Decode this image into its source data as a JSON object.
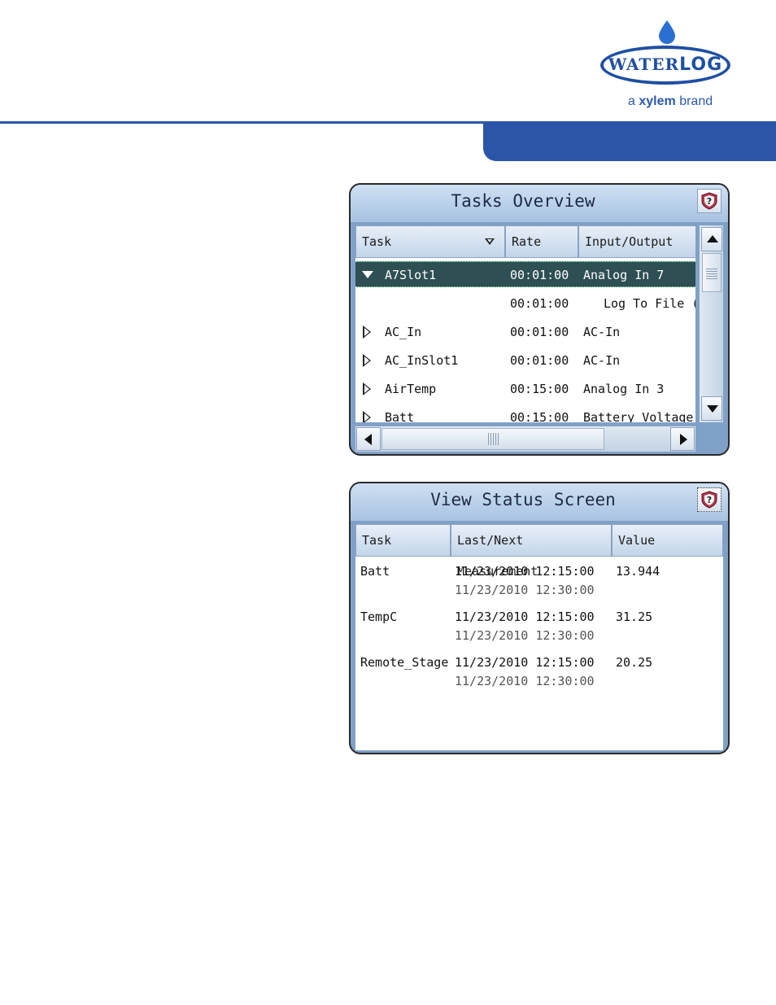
{
  "header": {
    "logo_left": "WATER",
    "logo_right": "LOG",
    "tagline_prefix": "a",
    "tagline_brand": "xylem",
    "tagline_suffix": "brand",
    "colors": {
      "brand_blue": "#2b56a8"
    }
  },
  "tasks_overview": {
    "title": "Tasks Overview",
    "help_icon": "help-shield-icon",
    "columns": [
      "Task",
      "Rate",
      "Input/Output"
    ],
    "rows": [
      {
        "task": "A7Slot1",
        "rate": "00:01:00",
        "io": "Analog In 7",
        "expanded": true,
        "selected": true
      },
      {
        "task": "",
        "rate": "00:01:00",
        "io": "Log To File (",
        "child": true
      },
      {
        "task": "AC_In",
        "rate": "00:01:00",
        "io": "AC-In"
      },
      {
        "task": "AC_InSlot1",
        "rate": "00:01:00",
        "io": "AC-In"
      },
      {
        "task": "AirTemp",
        "rate": "00:15:00",
        "io": "Analog In 3"
      },
      {
        "task": "Batt",
        "rate": "00:15:00",
        "io": "Battery Voltage"
      }
    ]
  },
  "view_status": {
    "title": "View Status Screen",
    "help_icon": "help-shield-icon",
    "columns": [
      "Task",
      "Last/Next Measurement",
      "Value"
    ],
    "rows": [
      {
        "task": "Batt",
        "last": "11/23/2010 12:15:00",
        "next": "11/23/2010 12:30:00",
        "value": "13.944"
      },
      {
        "task": "TempC",
        "last": "11/23/2010 12:15:00",
        "next": "11/23/2010 12:30:00",
        "value": "31.25"
      },
      {
        "task": "Remote_Stage",
        "last": "11/23/2010 12:15:00",
        "next": "11/23/2010 12:30:00",
        "value": "20.25"
      }
    ]
  }
}
